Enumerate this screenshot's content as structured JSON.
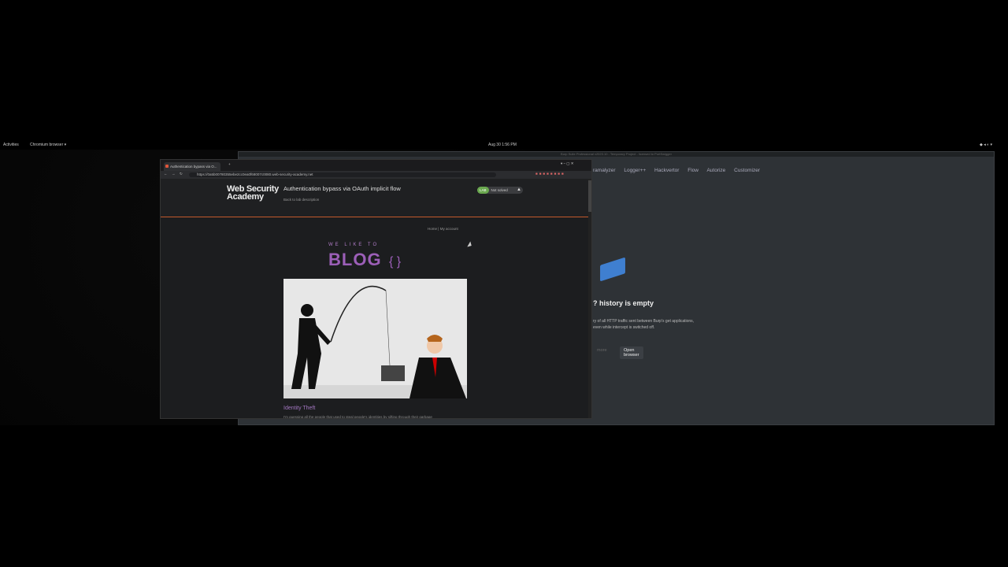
{
  "topbar": {
    "activities": "Activities",
    "app": "Chromium browser ▾",
    "clock": "Aug 30  1:56 PM"
  },
  "burp": {
    "window_title": "Burp Suite Professional v2023.10 - Temporary Project - licensed to PortSwigger",
    "tabs": [
      "ramalyzer",
      "Logger++",
      "Hackvertor",
      "Flow",
      "Autorize",
      "Customizer"
    ],
    "empty_heading": "? history is empty",
    "empty_description": "ry of all HTTP traffic sent between Burp's get applications, even while intercept is switched off.",
    "learn_more_label": "more",
    "open_browser_label": "Open browser"
  },
  "chrome": {
    "tab_title": "Authentication bypass via O...",
    "url": "https://0a5b00780355ebe2cc0ea0f68007c0080.web-security-academy.net"
  },
  "lab": {
    "logo_line1": "Web Security",
    "logo_line2": "Academy",
    "title": "Authentication bypass via OAuth implicit flow",
    "back_link": "Back to lab description",
    "badge_lab": "LAB",
    "badge_status": "Not solved",
    "nav_home": "Home",
    "nav_sep": "|",
    "nav_account": "My account"
  },
  "blog": {
    "tagline": "WE LIKE TO",
    "word": "BLOG",
    "post_title": "Identity Theft",
    "post_text": "I'm guessing all the people that used to steal people's identities by sifting through their garbage"
  },
  "colors": {
    "burp_bg": "#2e3236",
    "chrome_bg": "#202124",
    "accent_orange": "#c35a2b",
    "blog_purple": "#9c5fb8",
    "lab_green": "#6aa84f"
  }
}
